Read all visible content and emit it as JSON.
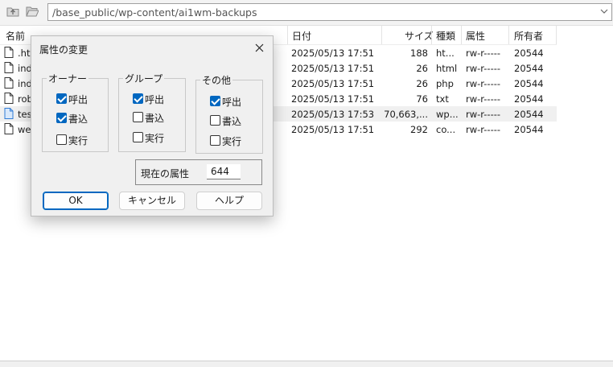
{
  "toolbar": {
    "path": "/base_public/wp-content/ai1wm-backups",
    "icons": [
      "folder-up-icon",
      "folder-open-icon",
      "dropdown-chevron-icon"
    ]
  },
  "columns": [
    "名前",
    "日付",
    "サイズ",
    "種類",
    "属性",
    "所有者"
  ],
  "files": [
    {
      "name": ".hta",
      "date": "2025/05/13 17:51",
      "size": "188",
      "type": "ht...",
      "attr": "rw-r-----",
      "owner": "20544",
      "selected": false
    },
    {
      "name": "ind",
      "date": "2025/05/13 17:51",
      "size": "26",
      "type": "html",
      "attr": "rw-r-----",
      "owner": "20544",
      "selected": false
    },
    {
      "name": "ind",
      "date": "2025/05/13 17:51",
      "size": "26",
      "type": "php",
      "attr": "rw-r-----",
      "owner": "20544",
      "selected": false
    },
    {
      "name": "rob",
      "date": "2025/05/13 17:51",
      "size": "76",
      "type": "txt",
      "attr": "rw-r-----",
      "owner": "20544",
      "selected": false
    },
    {
      "name": "test",
      "date": "2025/05/13 17:53",
      "size": "70,663,...",
      "type": "wp...",
      "attr": "rw-r-----",
      "owner": "20544",
      "selected": true
    },
    {
      "name": "wel",
      "date": "2025/05/13 17:51",
      "size": "292",
      "type": "co...",
      "attr": "rw-r-----",
      "owner": "20544",
      "selected": false
    }
  ],
  "dialog": {
    "title": "属性の変更",
    "groups": {
      "owner": {
        "label": "オーナー",
        "read": "呼出",
        "write": "書込",
        "exec": "実行",
        "read_checked": true,
        "write_checked": true,
        "exec_checked": false
      },
      "group": {
        "label": "グループ",
        "read": "呼出",
        "write": "書込",
        "exec": "実行",
        "read_checked": true,
        "write_checked": false,
        "exec_checked": false
      },
      "other": {
        "label": "その他",
        "read": "呼出",
        "write": "書込",
        "exec": "実行",
        "read_checked": true,
        "write_checked": false,
        "exec_checked": false
      }
    },
    "current_label": "現在の属性",
    "current_value": "644",
    "ok": "OK",
    "cancel": "キャンセル",
    "help": "ヘルプ"
  },
  "colors": {
    "accent": "#0067c0",
    "selected_row": "#f0f0f0",
    "dialog_bg": "#f0f0f0"
  }
}
